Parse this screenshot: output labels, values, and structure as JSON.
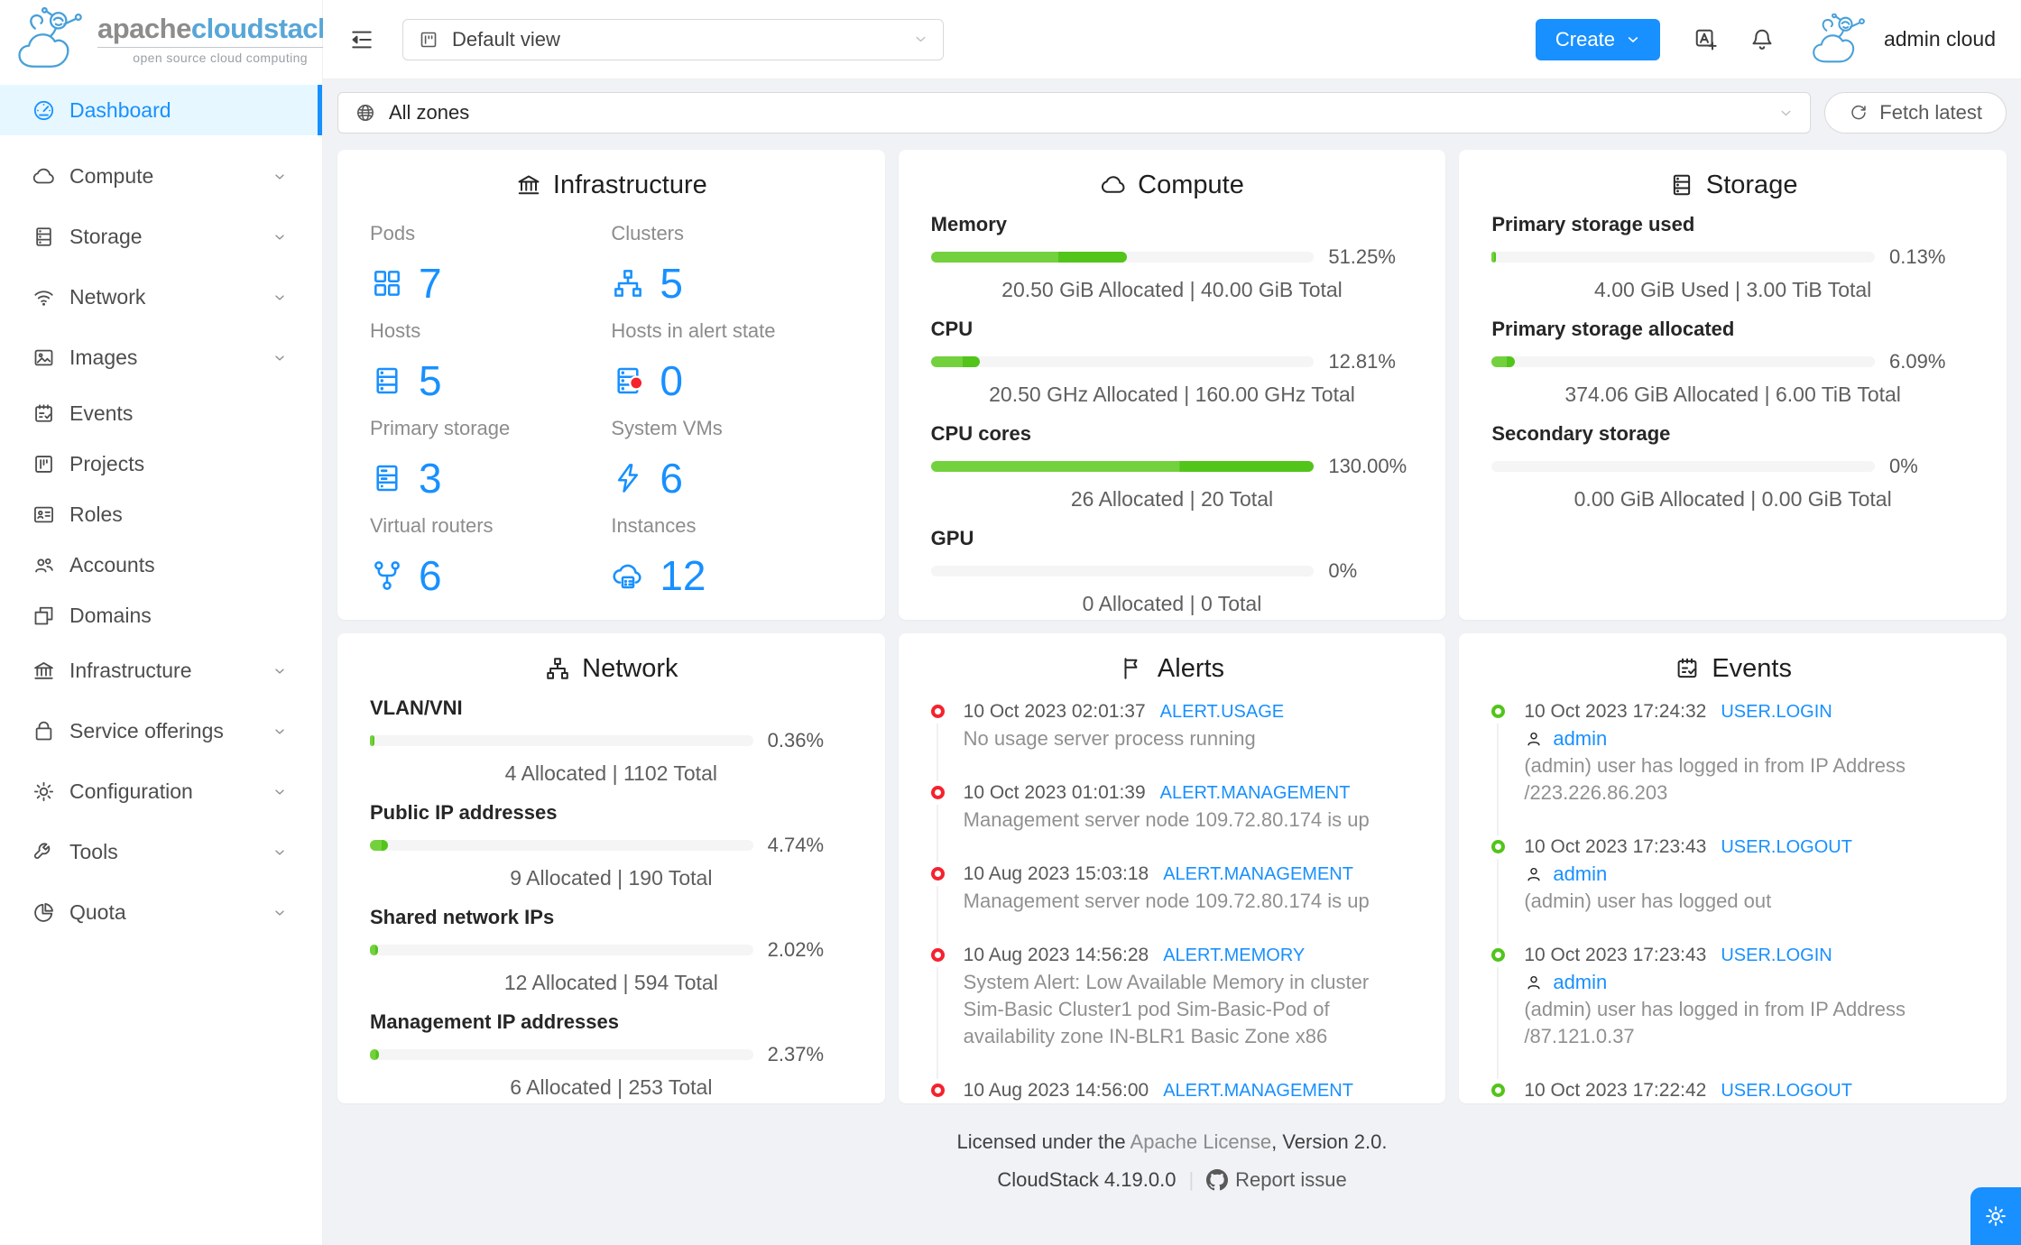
{
  "colors": {
    "accent": "#1890ff",
    "bar_light": "#73d13d",
    "bar_bright": "#52c41a",
    "alert_dot": "#f5222d",
    "event_dot": "#52c41a",
    "selected_bg": "#e6f7ff"
  },
  "brand": {
    "logo_primary": "apache",
    "logo_secondary": "cloudstack",
    "trademark": "™",
    "tagline": "open source cloud computing"
  },
  "topbar": {
    "view_selector": "Default view",
    "create_button": "Create",
    "user_name": "admin cloud"
  },
  "zonebar": {
    "zone_selector": "All zones",
    "fetch_button": "Fetch latest"
  },
  "sidebar": [
    {
      "id": "dashboard",
      "label": "Dashboard",
      "icon": "dashboard-icon",
      "selected": true,
      "chevron": false,
      "group": "short"
    },
    {
      "id": "compute",
      "label": "Compute",
      "icon": "cloud-icon",
      "selected": false,
      "chevron": true,
      "group": "tall"
    },
    {
      "id": "storage",
      "label": "Storage",
      "icon": "database-icon",
      "selected": false,
      "chevron": true,
      "group": "tall"
    },
    {
      "id": "network",
      "label": "Network",
      "icon": "wifi-icon",
      "selected": false,
      "chevron": true,
      "group": "tall"
    },
    {
      "id": "images",
      "label": "Images",
      "icon": "picture-icon",
      "selected": false,
      "chevron": true,
      "group": "tall"
    },
    {
      "id": "events",
      "label": "Events",
      "icon": "schedule-icon",
      "selected": false,
      "chevron": false,
      "group": "short"
    },
    {
      "id": "projects",
      "label": "Projects",
      "icon": "project-icon",
      "selected": false,
      "chevron": false,
      "group": "short"
    },
    {
      "id": "roles",
      "label": "Roles",
      "icon": "idcard-icon",
      "selected": false,
      "chevron": false,
      "group": "short"
    },
    {
      "id": "accounts",
      "label": "Accounts",
      "icon": "team-icon",
      "selected": false,
      "chevron": false,
      "group": "short"
    },
    {
      "id": "domains",
      "label": "Domains",
      "icon": "block-icon",
      "selected": false,
      "chevron": false,
      "group": "short"
    },
    {
      "id": "infrastructure",
      "label": "Infrastructure",
      "icon": "bank-icon",
      "selected": false,
      "chevron": true,
      "group": "tall"
    },
    {
      "id": "service-offerings",
      "label": "Service offerings",
      "icon": "shopping-icon",
      "selected": false,
      "chevron": true,
      "group": "tall"
    },
    {
      "id": "configuration",
      "label": "Configuration",
      "icon": "setting-icon",
      "selected": false,
      "chevron": true,
      "group": "tall"
    },
    {
      "id": "tools",
      "label": "Tools",
      "icon": "tool-icon",
      "selected": false,
      "chevron": true,
      "group": "tall"
    },
    {
      "id": "quota",
      "label": "Quota",
      "icon": "pie-icon",
      "selected": false,
      "chevron": true,
      "group": "tall"
    }
  ],
  "infrastructure_card": {
    "title": "Infrastructure",
    "icon": "bank-icon",
    "stats": [
      {
        "label": "Pods",
        "value": "7",
        "icon": "appstore-icon"
      },
      {
        "label": "Clusters",
        "value": "5",
        "icon": "cluster-icon"
      },
      {
        "label": "Hosts",
        "value": "5",
        "icon": "host-icon"
      },
      {
        "label": "Hosts in alert state",
        "value": "0",
        "icon": "host-alert-icon"
      },
      {
        "label": "Primary storage",
        "value": "3",
        "icon": "storage-icon"
      },
      {
        "label": "System VMs",
        "value": "6",
        "icon": "thunderbolt-icon"
      },
      {
        "label": "Virtual routers",
        "value": "6",
        "icon": "fork-icon"
      },
      {
        "label": "Instances",
        "value": "12",
        "icon": "cloud-server-icon"
      }
    ]
  },
  "compute_card": {
    "title": "Compute",
    "icon": "cloud-icon",
    "meters": [
      {
        "label": "Memory",
        "percent": 51.25,
        "percent_label": "51.25%",
        "subtitle": "20.50 GiB Allocated | 40.00 GiB Total"
      },
      {
        "label": "CPU",
        "percent": 12.81,
        "percent_label": "12.81%",
        "subtitle": "20.50 GHz Allocated | 160.00 GHz Total"
      },
      {
        "label": "CPU cores",
        "percent": 130,
        "percent_label": "130.00%",
        "subtitle": "26 Allocated | 20 Total"
      },
      {
        "label": "GPU",
        "percent": 0,
        "percent_label": "0%",
        "subtitle": "0 Allocated | 0 Total"
      }
    ]
  },
  "storage_card": {
    "title": "Storage",
    "icon": "database-icon",
    "meters": [
      {
        "label": "Primary storage used",
        "percent": 0.13,
        "percent_label": "0.13%",
        "subtitle": "4.00 GiB Used | 3.00 TiB Total"
      },
      {
        "label": "Primary storage allocated",
        "percent": 6.09,
        "percent_label": "6.09%",
        "subtitle": "374.06 GiB Allocated | 6.00 TiB Total"
      },
      {
        "label": "Secondary storage",
        "percent": 0,
        "percent_label": "0%",
        "subtitle": "0.00 GiB Allocated | 0.00 GiB Total"
      }
    ]
  },
  "network_card": {
    "title": "Network",
    "icon": "cluster-icon",
    "meters": [
      {
        "label": "VLAN/VNI",
        "percent": 0.36,
        "percent_label": "0.36%",
        "subtitle": "4 Allocated | 1102 Total"
      },
      {
        "label": "Public IP addresses",
        "percent": 4.74,
        "percent_label": "4.74%",
        "subtitle": "9 Allocated | 190 Total"
      },
      {
        "label": "Shared network IPs",
        "percent": 2.02,
        "percent_label": "2.02%",
        "subtitle": "12 Allocated | 594 Total"
      },
      {
        "label": "Management IP addresses",
        "percent": 2.37,
        "percent_label": "2.37%",
        "subtitle": "6 Allocated | 253 Total"
      }
    ]
  },
  "alerts_card": {
    "title": "Alerts",
    "icon": "flag-icon",
    "items": [
      {
        "time": "10 Oct 2023 02:01:37",
        "tag": "ALERT.USAGE",
        "text": "No usage server process running"
      },
      {
        "time": "10 Oct 2023 01:01:39",
        "tag": "ALERT.MANAGEMENT",
        "text": "Management server node 109.72.80.174 is up"
      },
      {
        "time": "10 Aug 2023 15:03:18",
        "tag": "ALERT.MANAGEMENT",
        "text": "Management server node 109.72.80.174 is up"
      },
      {
        "time": "10 Aug 2023 14:56:28",
        "tag": "ALERT.MEMORY",
        "text": "System Alert: Low Available Memory in cluster Sim-Basic Cluster1 pod Sim-Basic-Pod of availability zone IN-BLR1 Basic Zone x86"
      },
      {
        "time": "10 Aug 2023 14:56:00",
        "tag": "ALERT.MANAGEMENT",
        "text": ""
      }
    ]
  },
  "events_card": {
    "title": "Events",
    "icon": "schedule-icon",
    "items": [
      {
        "time": "10 Oct 2023 17:24:32",
        "tag": "USER.LOGIN",
        "user": "admin",
        "text": "(admin) user has logged in from IP Address /223.226.86.203"
      },
      {
        "time": "10 Oct 2023 17:23:43",
        "tag": "USER.LOGOUT",
        "user": "admin",
        "text": "(admin) user has logged out"
      },
      {
        "time": "10 Oct 2023 17:23:43",
        "tag": "USER.LOGIN",
        "user": "admin",
        "text": "(admin) user has logged in from IP Address /87.121.0.37"
      },
      {
        "time": "10 Oct 2023 17:22:42",
        "tag": "USER.LOGOUT",
        "user": "",
        "text": ""
      }
    ]
  },
  "footer": {
    "line1_prefix": "Licensed under the ",
    "line1_link": "Apache License",
    "line1_suffix": ", Version 2.0.",
    "version": "CloudStack 4.19.0.0",
    "separator": "|",
    "report_link": "Report issue"
  }
}
